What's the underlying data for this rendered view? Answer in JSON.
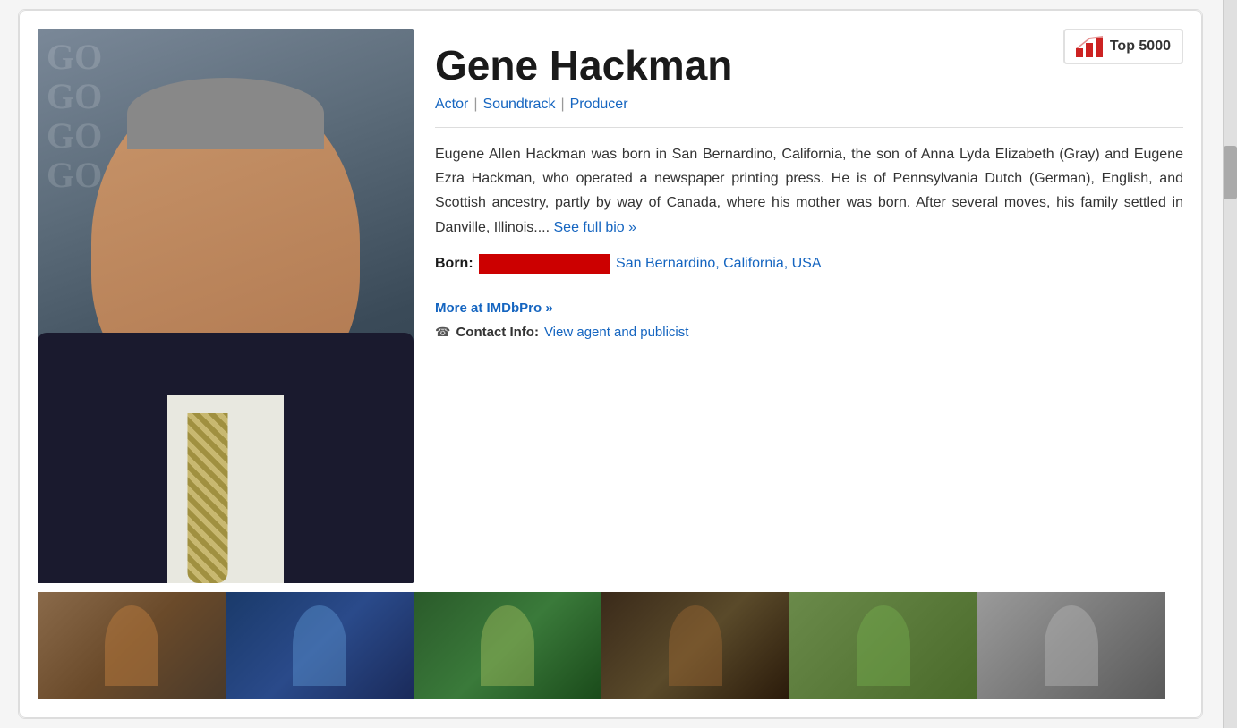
{
  "person": {
    "name": "Gene Hackman",
    "roles": [
      "Actor",
      "Soundtrack",
      "Producer"
    ],
    "role_separators": [
      "|",
      "|"
    ],
    "bio": "Eugene Allen Hackman was born in San Bernardino, California, the son of Anna Lyda Elizabeth (Gray) and Eugene Ezra Hackman, who operated a newspaper printing press. He is of Pennsylvania Dutch (German), English, and Scottish ancestry, partly by way of Canada, where his mother was born. After several moves, his family settled in Danville, Illinois....",
    "see_full_bio_label": "See full bio »",
    "born_label": "Born:",
    "born_date_redacted": "XXXXXXXXXXX",
    "born_location": "San Bernardino, California, USA",
    "imdbpro_label": "More at IMDbPro »",
    "contact_info_label": "Contact Info:",
    "contact_link_label": "View agent and publicist",
    "top5000_label": "Top 5000",
    "photo_bg_text": "GO\nGO\nGO"
  },
  "thumbnails": [
    {
      "id": 1,
      "alt": "Film still 1"
    },
    {
      "id": 2,
      "alt": "Film still 2"
    },
    {
      "id": 3,
      "alt": "Film still 3"
    },
    {
      "id": 4,
      "alt": "Film still 4"
    },
    {
      "id": 5,
      "alt": "Film still 5"
    },
    {
      "id": 6,
      "alt": "Film still 6"
    }
  ],
  "colors": {
    "link": "#1565c0",
    "accent_red": "#cc2222",
    "text_dark": "#1a1a1a",
    "text_body": "#333333",
    "border": "#dddddd"
  }
}
